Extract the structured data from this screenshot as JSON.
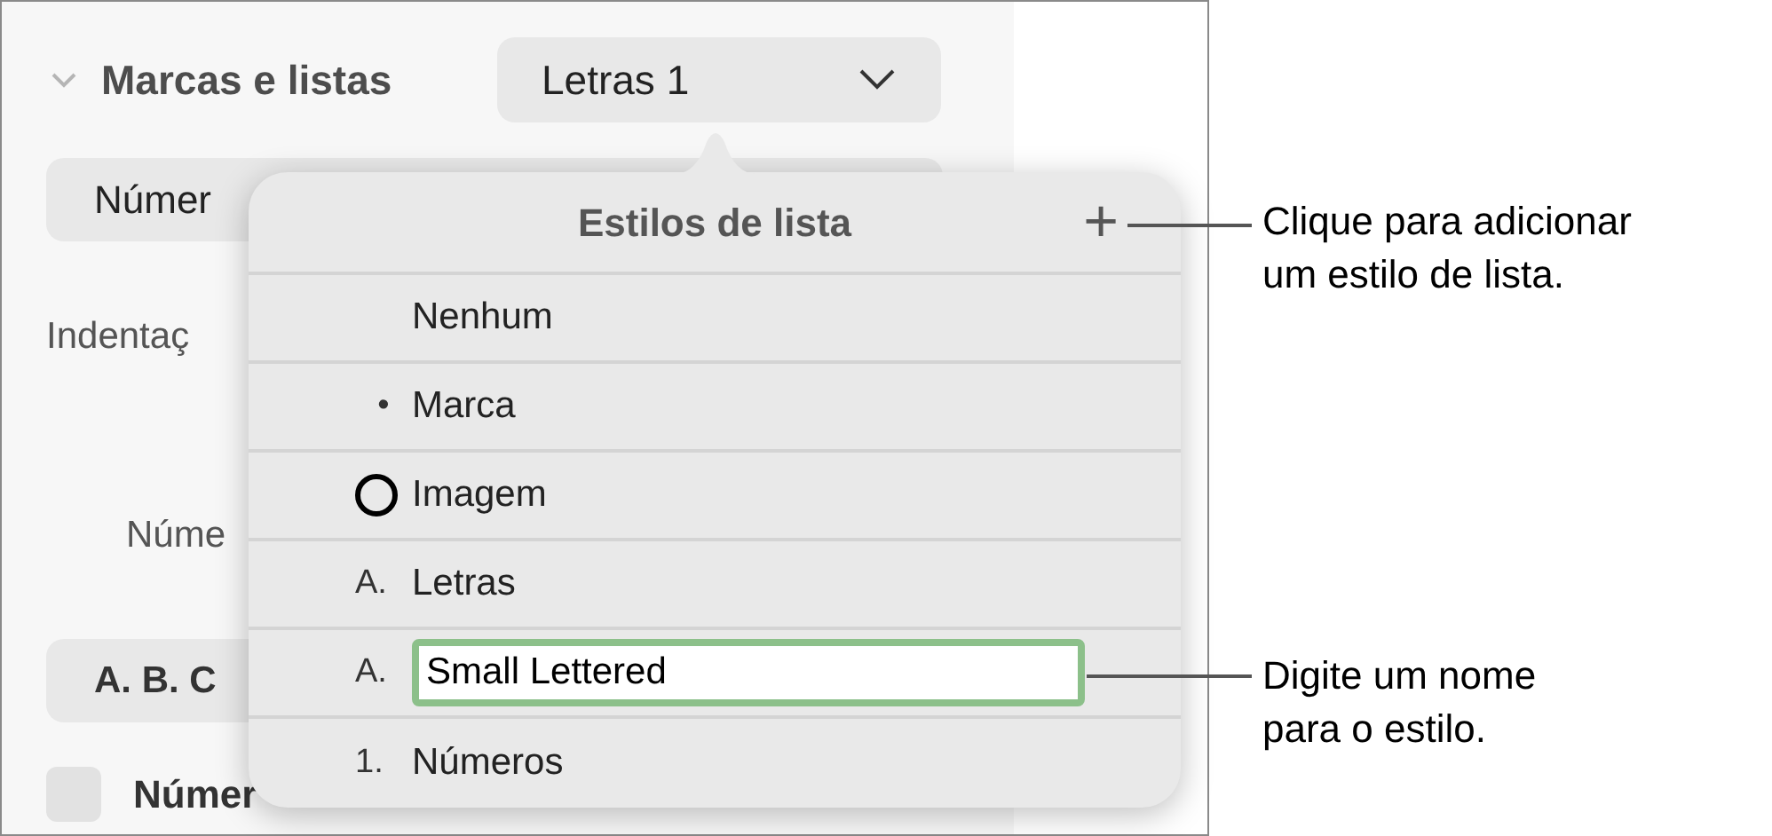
{
  "sidebar": {
    "section_title": "Marcas e listas",
    "expanded": true,
    "style_dropdown": "Letras 1",
    "number_button": "Númer",
    "indent_label": "Indentaç",
    "number_label": "Núme",
    "format_button": "A. B. C",
    "tiered_checkbox": {
      "label": "Númer",
      "checked": false
    }
  },
  "popover": {
    "title": "Estilos de lista",
    "add_button": "+",
    "items": [
      {
        "kind": "plain",
        "label": "Nenhum"
      },
      {
        "kind": "text",
        "marker": "•",
        "label": "Marca"
      },
      {
        "kind": "image",
        "label": "Imagem"
      },
      {
        "kind": "text",
        "marker": "A.",
        "label": "Letras"
      },
      {
        "kind": "field",
        "marker": "A.",
        "value": "Small Lettered"
      },
      {
        "kind": "text",
        "marker": "1.",
        "label": "Números"
      }
    ]
  },
  "callouts": [
    {
      "lines": [
        "Clique para adicionar",
        "um estilo de lista."
      ]
    },
    {
      "lines": [
        "Digite um nome",
        "para o estilo."
      ]
    }
  ]
}
